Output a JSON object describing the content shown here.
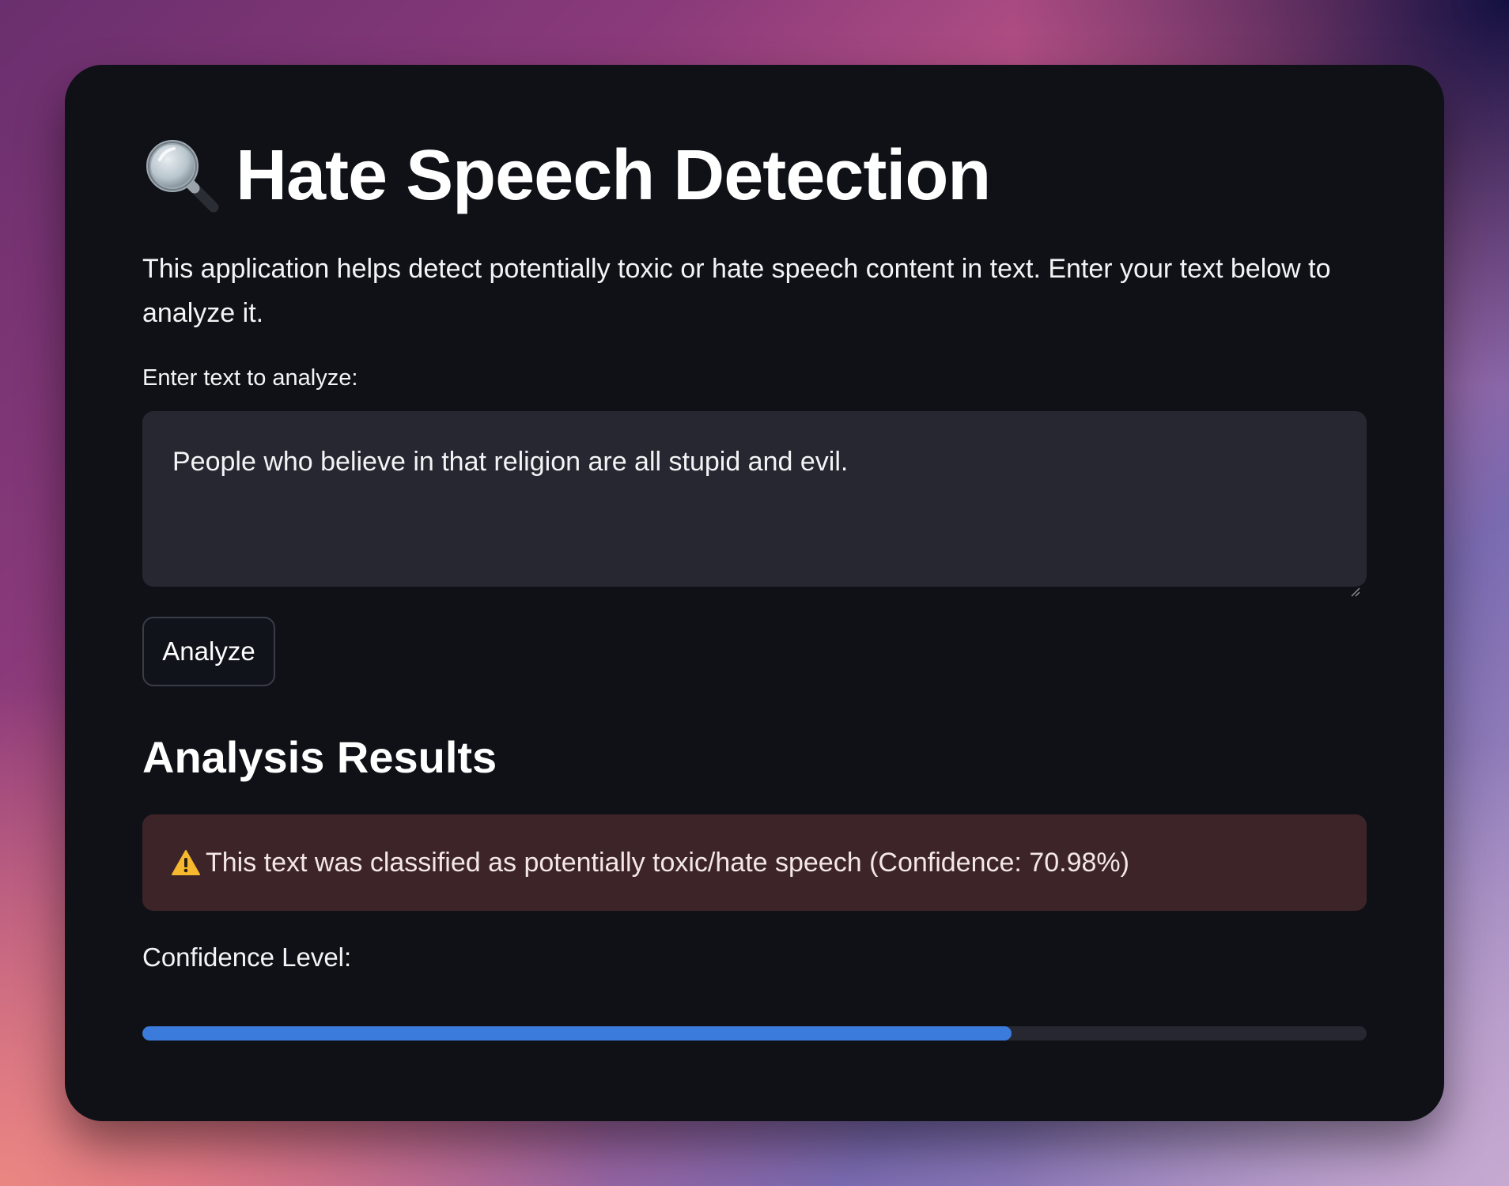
{
  "app": {
    "title": "Hate Speech Detection",
    "title_icon": "magnifying-glass-icon",
    "description": "This application helps detect potentially toxic or hate speech content in text. Enter your text below to analyze it."
  },
  "input": {
    "label": "Enter text to analyze:",
    "value": "People who believe in that religion are all stupid and evil."
  },
  "actions": {
    "analyze_label": "Analyze"
  },
  "results": {
    "heading": "Analysis Results",
    "alert_icon": "warning-icon",
    "alert_text": "This text was classified as potentially toxic/hate speech (Confidence: 70.98%)",
    "confidence_label": "Confidence Level:",
    "confidence_value": 0.7098
  },
  "colors": {
    "progress_fill": "#3b7bdb",
    "alert_background": "#3d2428",
    "panel_background": "#0f1117"
  }
}
